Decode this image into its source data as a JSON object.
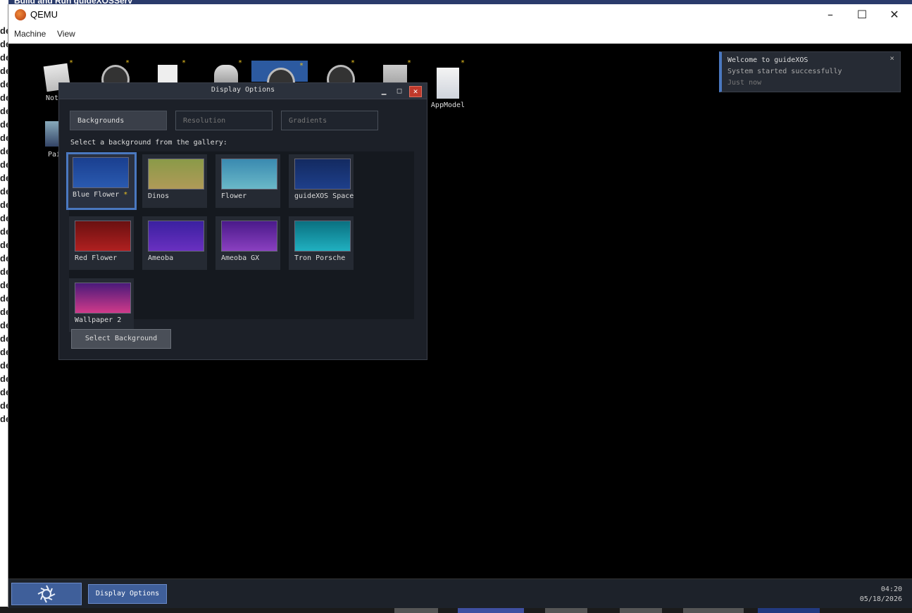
{
  "host": {
    "tab_title": "Build and Run guideXOSServ",
    "left_text": "de"
  },
  "qemu": {
    "title": "QEMU",
    "menu": [
      "Machine",
      "View"
    ]
  },
  "desktop": {
    "icons": [
      {
        "label": "Noter"
      },
      {
        "label": ""
      },
      {
        "label": ""
      },
      {
        "label": ""
      },
      {
        "label": ""
      },
      {
        "label": ""
      },
      {
        "label": ""
      },
      {
        "label": "AppModel"
      },
      {
        "label": "Pair"
      }
    ]
  },
  "window": {
    "title": "Display Options",
    "tabs": [
      "Backgrounds",
      "Resolution",
      "Gradients"
    ],
    "active_tab": "Backgrounds",
    "prompt": "Select a background from the gallery:",
    "tiles": [
      {
        "name": "Blue Flower",
        "current": "*",
        "colors": [
          "#1a3f8f",
          "#2a5ab0"
        ]
      },
      {
        "name": "Dinos",
        "colors": [
          "#8a9a48",
          "#b09a58"
        ]
      },
      {
        "name": "Flower",
        "colors": [
          "#3a8ab0",
          "#6ab8c8"
        ]
      },
      {
        "name": "guideXOS Space",
        "colors": [
          "#132a60",
          "#1e3f8a"
        ]
      },
      {
        "name": "Red Flower",
        "colors": [
          "#6a1010",
          "#b02020"
        ]
      },
      {
        "name": "Ameoba",
        "colors": [
          "#3a20a0",
          "#6a30c0"
        ]
      },
      {
        "name": "Ameoba GX",
        "colors": [
          "#4a1a8a",
          "#8a40c0"
        ]
      },
      {
        "name": "Tron Porsche",
        "colors": [
          "#0a7080",
          "#20b0c0"
        ]
      },
      {
        "name": "Wallpaper 2",
        "colors": [
          "#4a1a7a",
          "#d03a8a"
        ]
      }
    ],
    "select_button": "Select Background"
  },
  "notification": {
    "title": "Welcome to guideXOS",
    "message": "System started successfully",
    "time": "Just now",
    "close": "×"
  },
  "taskbar": {
    "task": "Display Options",
    "time": "04:20",
    "date": "05/18/2026"
  }
}
